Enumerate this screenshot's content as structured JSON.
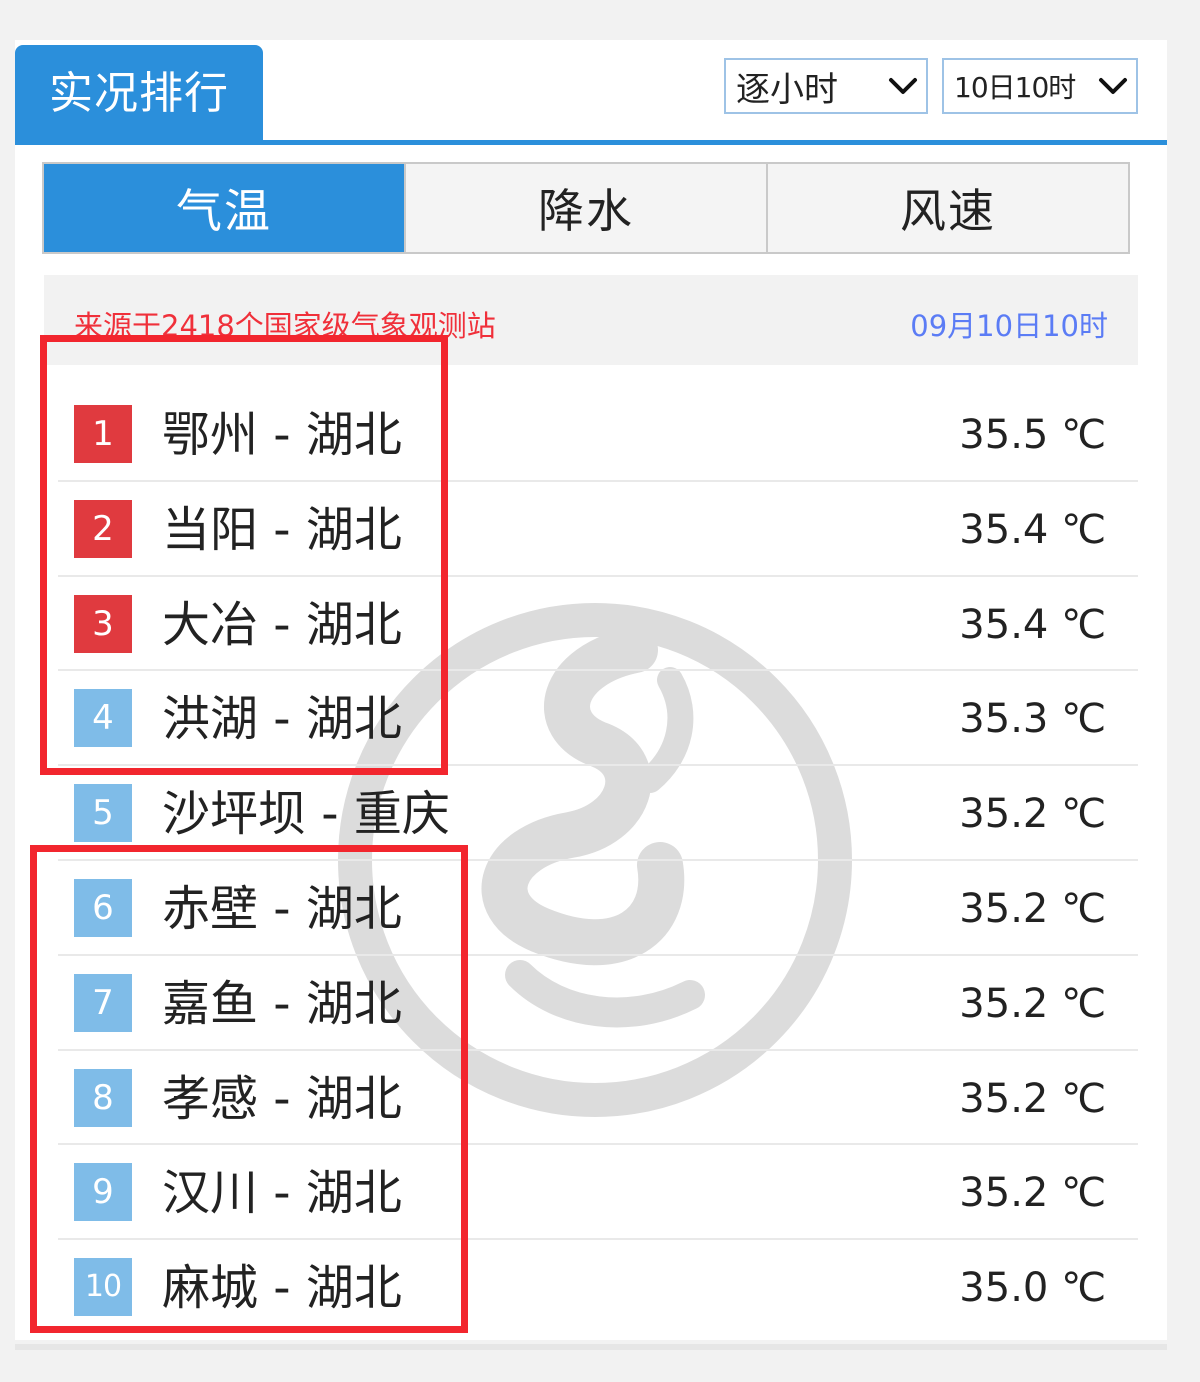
{
  "header": {
    "title": "实况排行",
    "mode_select": {
      "value": "逐小时",
      "icon": "chevron-down-icon"
    },
    "time_select": {
      "value": "10日10时",
      "icon": "chevron-down-icon"
    }
  },
  "tabs": [
    {
      "label": "气温",
      "active": true
    },
    {
      "label": "降水",
      "active": false
    },
    {
      "label": "风速",
      "active": false
    }
  ],
  "info": {
    "source": "来源于2418个国家级气象观测站",
    "time": "09月10日10时"
  },
  "ranking": [
    {
      "rank": "1",
      "place": "鄂州 - 湖北",
      "temp": "35.5 ℃"
    },
    {
      "rank": "2",
      "place": "当阳 - 湖北",
      "temp": "35.4 ℃"
    },
    {
      "rank": "3",
      "place": "大冶 - 湖北",
      "temp": "35.4 ℃"
    },
    {
      "rank": "4",
      "place": "洪湖 - 湖北",
      "temp": "35.3 ℃"
    },
    {
      "rank": "5",
      "place": "沙坪坝 - 重庆",
      "temp": "35.2 ℃"
    },
    {
      "rank": "6",
      "place": "赤壁 - 湖北",
      "temp": "35.2 ℃"
    },
    {
      "rank": "7",
      "place": "嘉鱼 - 湖北",
      "temp": "35.2 ℃"
    },
    {
      "rank": "8",
      "place": "孝感 - 湖北",
      "temp": "35.2 ℃"
    },
    {
      "rank": "9",
      "place": "汉川 - 湖北",
      "temp": "35.2 ℃"
    },
    {
      "rank": "10",
      "place": "麻城 - 湖北",
      "temp": "35.0 ℃"
    }
  ],
  "colors": {
    "accent": "#2b8fdb",
    "top_rank": "#e03a3f",
    "rank": "#7fbce8",
    "source_text": "#f0303a",
    "time_text": "#5b7cf5",
    "highlight": "#f2262e"
  }
}
